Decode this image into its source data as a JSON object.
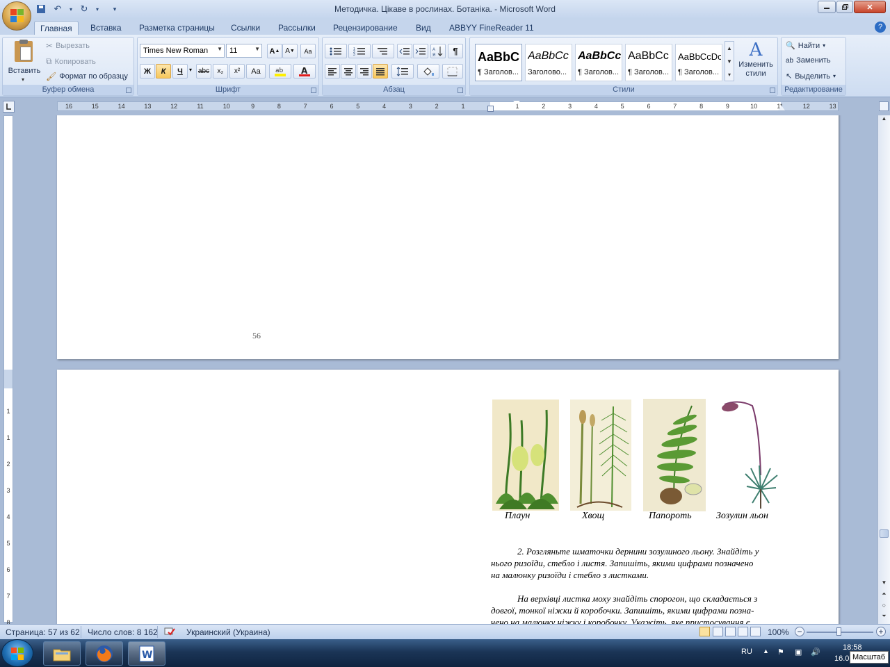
{
  "window": {
    "title": "Методичка. Цікаве в рослинах. Ботаніка. - Microsoft Word"
  },
  "tabs": [
    "Главная",
    "Вставка",
    "Разметка страницы",
    "Ссылки",
    "Рассылки",
    "Рецензирование",
    "Вид",
    "ABBYY FineReader 11"
  ],
  "ribbon": {
    "clipboard": {
      "paste": "Вставить",
      "cut": "Вырезать",
      "copy": "Копировать",
      "format_painter": "Формат по образцу",
      "label": "Буфер обмена"
    },
    "font": {
      "name": "Times New Roman",
      "size": "11",
      "bold": "Ж",
      "italic": "К",
      "underline": "Ч",
      "strike": "abc",
      "subscript": "x₂",
      "superscript": "x²",
      "case": "Aa",
      "label": "Шрифт"
    },
    "paragraph": {
      "label": "Абзац"
    },
    "styles": {
      "label": "Стили",
      "tiles": [
        {
          "sample": "AaBbC",
          "name": "¶ Заголов..."
        },
        {
          "sample": "AaBbCc",
          "name": "Заголово..."
        },
        {
          "sample": "AaBbCc",
          "name": "¶ Заголов..."
        },
        {
          "sample": "AaBbCc",
          "name": "¶ Заголов..."
        },
        {
          "sample": "AaBbCcDc",
          "name": "¶ Заголов..."
        }
      ],
      "change_styles": "Изменить стили"
    },
    "editing": {
      "label": "Редактирование",
      "find": "Найти",
      "replace": "Заменить",
      "select": "Выделить"
    }
  },
  "ruler": {
    "h_left": [
      "16",
      "15",
      "14",
      "13",
      "12",
      "11",
      "10",
      "9",
      "8",
      "7",
      "6",
      "5",
      "4",
      "3",
      "2",
      "1"
    ],
    "h_right": [
      "1",
      "2",
      "3",
      "4",
      "5",
      "6",
      "7",
      "8",
      "9",
      "10",
      "11",
      "12",
      "13"
    ],
    "v": [
      "1",
      "1",
      "2",
      "3",
      "4",
      "5",
      "6",
      "7",
      "8"
    ]
  },
  "document": {
    "page_number": "56",
    "captions": [
      "Плаун",
      "Хвощ",
      "Папороть",
      "Зозулин льон"
    ],
    "para1_lines": [
      "2. Розгляньте шматочки дернини зозулиного льону. Знайдіть у",
      "нього ризоїди, стебло і листя. Запишіть, якими цифрами позначено",
      "на малюнку ризоїди і стебло з листками."
    ],
    "para2_lines": [
      "На верхівці листка моху знайдіть спорогон, що складається з",
      "довгої, тонкої ніжки й коробочки. Запишіть, якими цифрами позна-",
      "чено на малюнку ніжку і коробочку. Укажіть, яке пристосування є"
    ]
  },
  "status": {
    "page": "Страница: 57 из 62",
    "words": "Число слов: 8 162",
    "language": "Украинский (Украина)",
    "zoom": "100%"
  },
  "taskbar": {
    "lang": "RU",
    "time": "18:58",
    "date": "16.0",
    "tooltip": "Масштаб"
  },
  "colors": {
    "app_bg": "#a9bbd6",
    "ribbon": "#dbe6f6",
    "accent": "#f7c75a"
  }
}
